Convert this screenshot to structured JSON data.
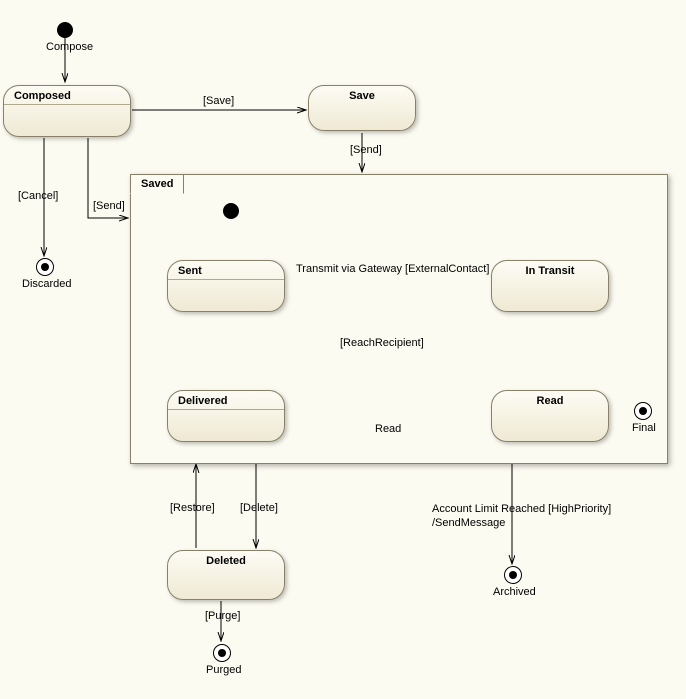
{
  "initialLabel": "Compose",
  "states": {
    "composed": "Composed",
    "save": "Save",
    "saved": "Saved",
    "sent": "Sent",
    "inTransit": "In Transit",
    "delivered": "Delivered",
    "read": "Read",
    "deleted": "Deleted"
  },
  "transitions": {
    "save": "[Save]",
    "send": "[Send]",
    "cancel": "[Cancel]",
    "transmit": "Transmit via Gateway [ExternalContact]",
    "reach": "[ReachRecipient]",
    "readAction": "Read",
    "restore": "[Restore]",
    "delete": "[Delete]",
    "account": "Account Limit Reached [HighPriority]\n/SendMessage",
    "purge": "[Purge]"
  },
  "finals": {
    "discarded": "Discarded",
    "final": "Final",
    "archived": "Archived",
    "purged": "Purged"
  }
}
